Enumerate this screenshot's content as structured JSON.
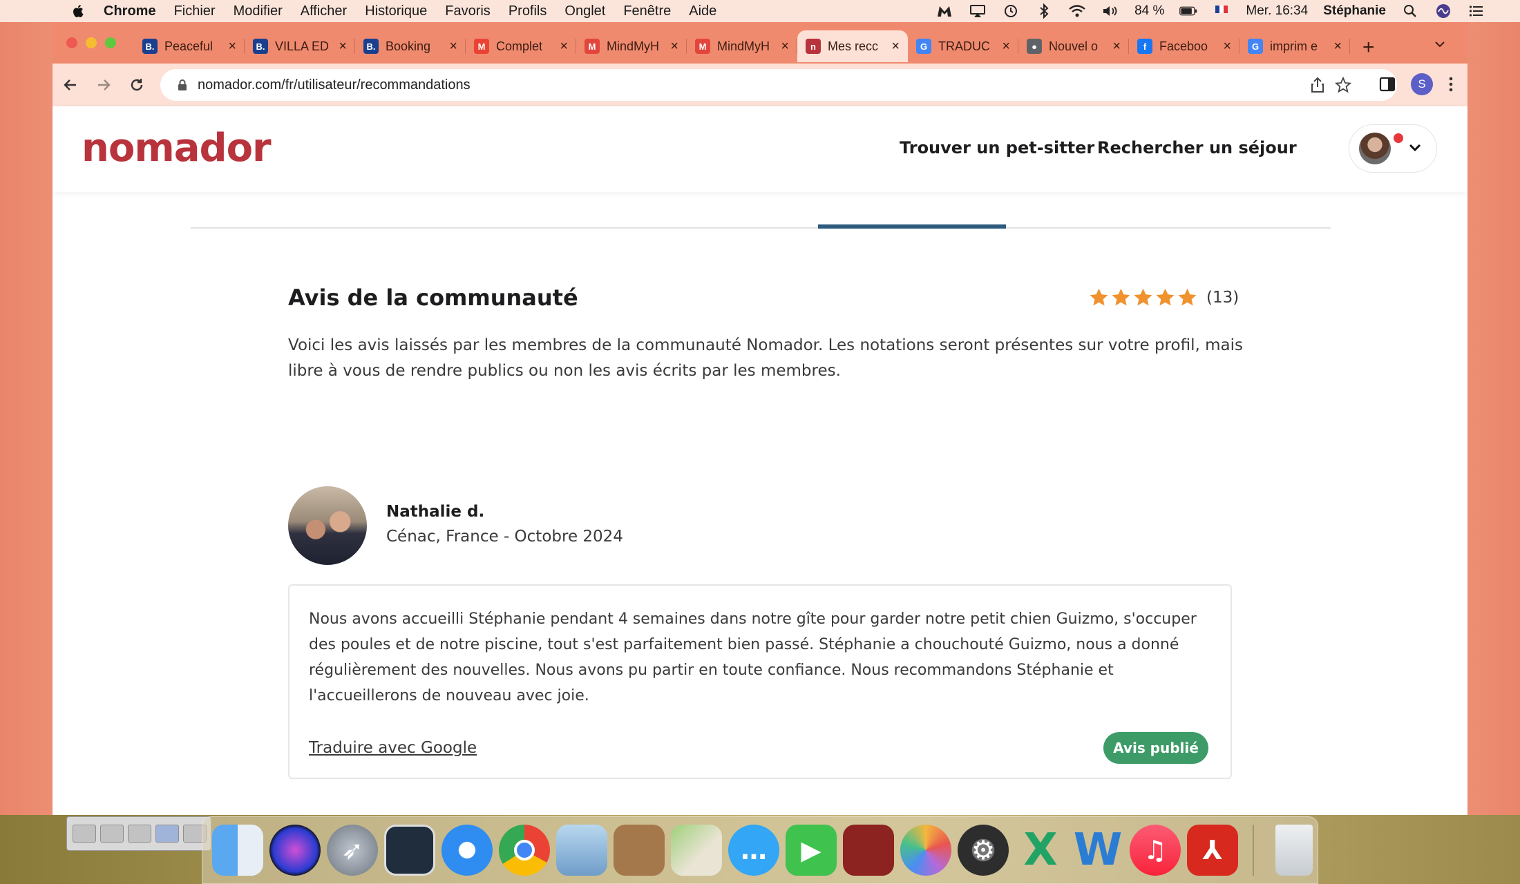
{
  "menubar": {
    "app_name": "Chrome",
    "items": [
      "Fichier",
      "Modifier",
      "Afficher",
      "Historique",
      "Favoris",
      "Profils",
      "Onglet",
      "Fenêtre",
      "Aide"
    ],
    "battery": "84 %",
    "datetime": "Mer. 16:34",
    "user": "Stéphanie"
  },
  "browser": {
    "tabs": [
      {
        "title": "Peaceful",
        "favicon": "B.",
        "color": "#1a3f8f",
        "active": false
      },
      {
        "title": "VILLA ED",
        "favicon": "B.",
        "color": "#1a3f8f",
        "active": false
      },
      {
        "title": "Booking",
        "favicon": "B.",
        "color": "#1a3f8f",
        "active": false
      },
      {
        "title": "Complet",
        "favicon": "M",
        "color": "#ea4335",
        "active": false
      },
      {
        "title": "MindMyH",
        "favicon": "M",
        "color": "#e2453c",
        "active": false
      },
      {
        "title": "MindMyH",
        "favicon": "M",
        "color": "#e2453c",
        "active": false
      },
      {
        "title": "Mes recc",
        "favicon": "n",
        "color": "#b8333b",
        "active": true
      },
      {
        "title": "TRADUC",
        "favicon": "G",
        "color": "#4285f4",
        "active": false
      },
      {
        "title": "Nouvel o",
        "favicon": "●",
        "color": "#5f6368",
        "active": false
      },
      {
        "title": "Faceboo",
        "favicon": "f",
        "color": "#1877f2",
        "active": false
      },
      {
        "title": "imprim e",
        "favicon": "G",
        "color": "#4285f4",
        "active": false
      }
    ],
    "url": "nomador.com/fr/utilisateur/recommandations",
    "profile_initial": "S"
  },
  "site": {
    "logo_text": "nomador",
    "nav": {
      "find_sitter": "Trouver un pet-sitter",
      "search_stay": "Rechercher un séjour"
    }
  },
  "reviews": {
    "title": "Avis de la communauté",
    "rating": 5,
    "rating_count": "(13)",
    "intro": "Voici les avis laissés par les membres de la communauté Nomador. Les notations seront présentes sur votre profil, mais libre à vous de rendre publics ou non les avis écrits par les membres.",
    "items": [
      {
        "author": "Nathalie d.",
        "meta": "Cénac, France - Octobre 2024",
        "text": "Nous avons accueilli Stéphanie pendant 4 semaines dans notre gîte pour garder notre petit chien Guizmo, s'occuper des poules et de notre piscine, tout s'est parfaitement bien passé. Stéphanie a chouchouté Guizmo, nous a donné régulièrement des nouvelles. Nous avons pu partir en toute confiance. Nous recommandons Stéphanie et l'accueillerons de nouveau avec joie.",
        "translate_label": "Traduire avec Google",
        "status": "Avis publié"
      }
    ]
  },
  "colors": {
    "brand": "#b8333b",
    "star": "#f0922e",
    "badge": "#3d9b67",
    "tab_indicator": "#2b5a7d"
  },
  "dock": {
    "icons": [
      "finder",
      "siri",
      "launchpad",
      "photo-booth-style",
      "safari",
      "chrome",
      "preview",
      "contacts",
      "maps",
      "messages",
      "facetime",
      "photo-booth",
      "photos",
      "system-preferences",
      "excel",
      "word",
      "music",
      "acrobat",
      "trash"
    ]
  }
}
